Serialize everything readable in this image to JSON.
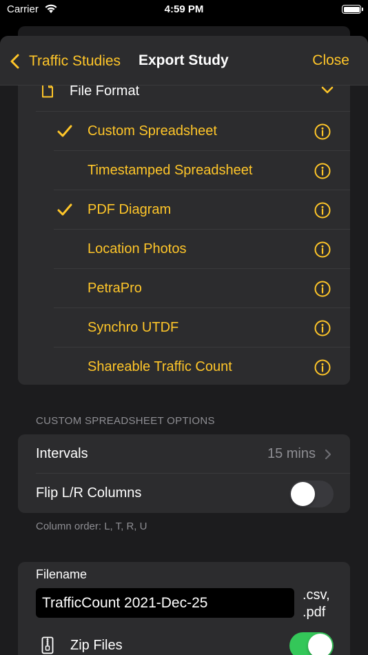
{
  "status_bar": {
    "carrier": "Carrier",
    "time": "4:59 PM"
  },
  "nav": {
    "back_label": "Traffic Studies",
    "title": "Export Study",
    "close_label": "Close"
  },
  "file_format": {
    "header_label": "File Format",
    "options": [
      {
        "label": "Custom Spreadsheet",
        "checked": true
      },
      {
        "label": "Timestamped Spreadsheet",
        "checked": false
      },
      {
        "label": "PDF Diagram",
        "checked": true
      },
      {
        "label": "Location Photos",
        "checked": false
      },
      {
        "label": "PetraPro",
        "checked": false
      },
      {
        "label": "Synchro UTDF",
        "checked": false
      },
      {
        "label": "Shareable Traffic Count",
        "checked": false
      }
    ]
  },
  "custom_options": {
    "section_header": "CUSTOM SPREADSHEET OPTIONS",
    "intervals_label": "Intervals",
    "intervals_value": "15 mins",
    "flip_label": "Flip L/R Columns",
    "flip_on": false,
    "footer": "Column order: L, T, R, U"
  },
  "filename": {
    "label": "Filename",
    "value": "TrafficCount 2021-Dec-25",
    "extensions_line1": ".csv,",
    "extensions_line2": ".pdf",
    "zip_label": "Zip Files",
    "zip_on": true
  },
  "colors": {
    "accent": "#ffc629",
    "toggle_on": "#34c759",
    "background": "#1c1c1e",
    "cell": "#2c2c2e"
  }
}
